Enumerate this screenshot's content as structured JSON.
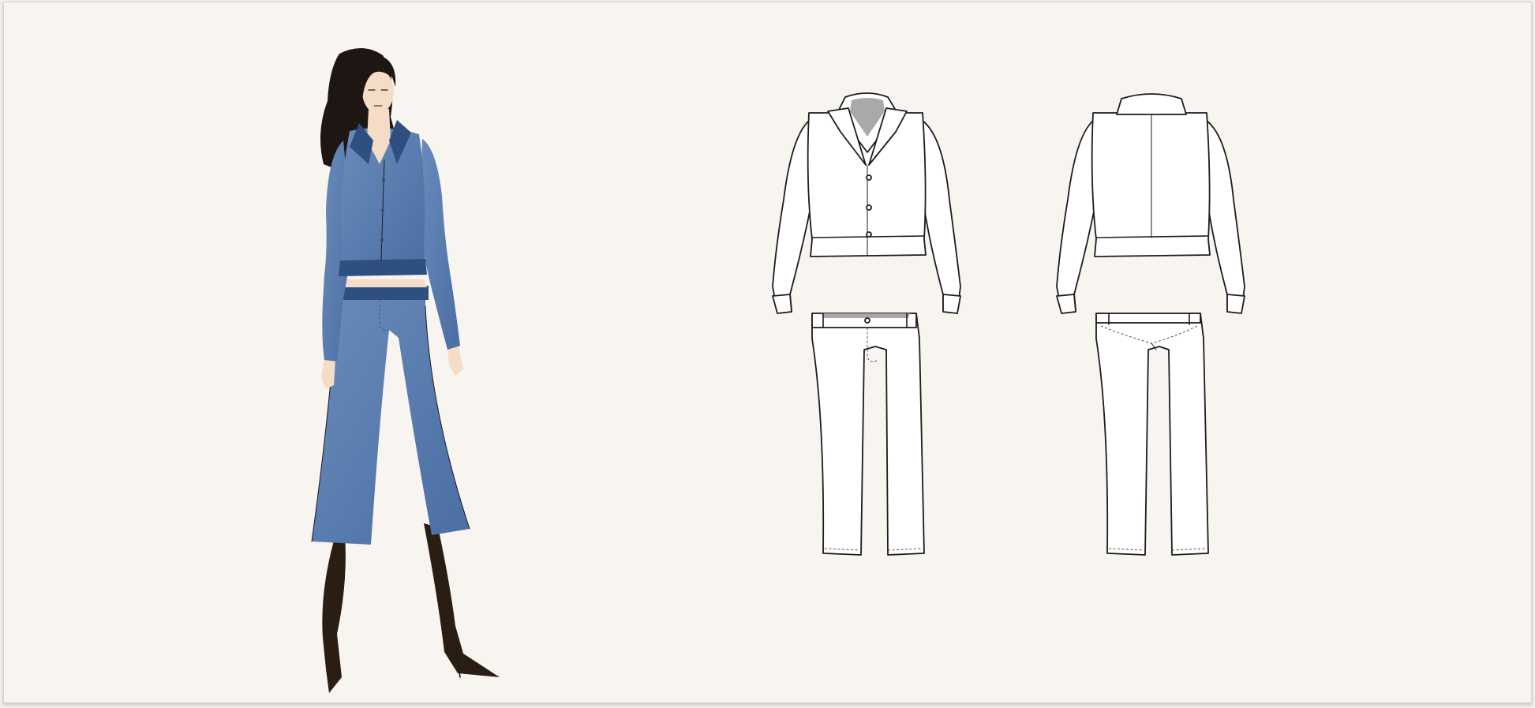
{
  "palette": {
    "background": "#f8f4f0",
    "denim": "#4a6ea3",
    "denim_dark": "#2f4f80",
    "denim_light": "#6a8cbb",
    "hair": "#1e1612",
    "skin": "#f5dcc7",
    "tights": "#2a1d14",
    "collar_lining": "#a9a9a9",
    "line_ink": "#1c1c1c",
    "stitch_ink": "#555555"
  },
  "figures": [
    {
      "name": "fashion-illustration",
      "view": "model-wearing-outfit"
    },
    {
      "name": "flat-sketch",
      "view": "front"
    },
    {
      "name": "flat-sketch",
      "view": "back"
    }
  ]
}
